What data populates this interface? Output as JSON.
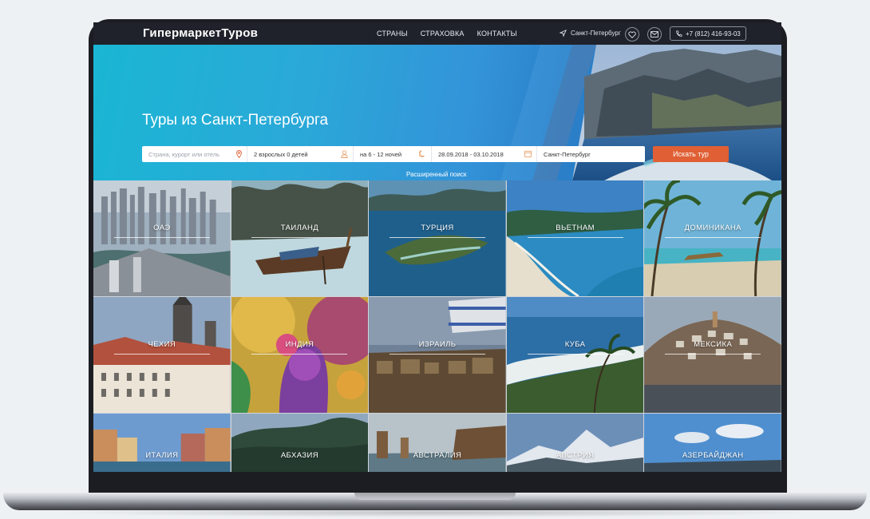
{
  "header": {
    "logo": "ГипермаркетТуров",
    "nav": [
      "СТРАНЫ",
      "СТРАХОВКА",
      "КОНТАКТЫ"
    ],
    "city": "Санкт-Петербург",
    "phone": "+7 (812) 416-93-03"
  },
  "hero": {
    "title": "Туры из Санкт-Петербурга",
    "search": {
      "destination_placeholder": "Страна, курорт или отель",
      "guests": "2 взрослых 0 детей",
      "nights": "на 6 - 12 ночей",
      "dates": "28.09.2018 - 03.10.2018",
      "departure": "Санкт-Петербург",
      "submit_label": "Искать тур"
    },
    "advanced_search": "Расширенный поиск"
  },
  "destinations": [
    {
      "name": "ОАЭ"
    },
    {
      "name": "ТАИЛАНД"
    },
    {
      "name": "ТУРЦИЯ"
    },
    {
      "name": "ВЬЕТНАМ"
    },
    {
      "name": "ДОМИНИКАНА"
    },
    {
      "name": "ЧЕХИЯ"
    },
    {
      "name": "ИНДИЯ"
    },
    {
      "name": "ИЗРАИЛЬ"
    },
    {
      "name": "КУБА"
    },
    {
      "name": "МЕКСИКА"
    },
    {
      "name": "ИТАЛИЯ"
    },
    {
      "name": "АБХАЗИЯ"
    },
    {
      "name": "АВСТРАЛИЯ"
    },
    {
      "name": "АВСТРИЯ"
    },
    {
      "name": "АЗЕРБАЙДЖАН"
    }
  ],
  "colors": {
    "header_bg": "#1f222a",
    "accent": "#e05f34",
    "hero_gradient_start": "#1ab6d4",
    "hero_gradient_end": "#2a7fc8"
  }
}
